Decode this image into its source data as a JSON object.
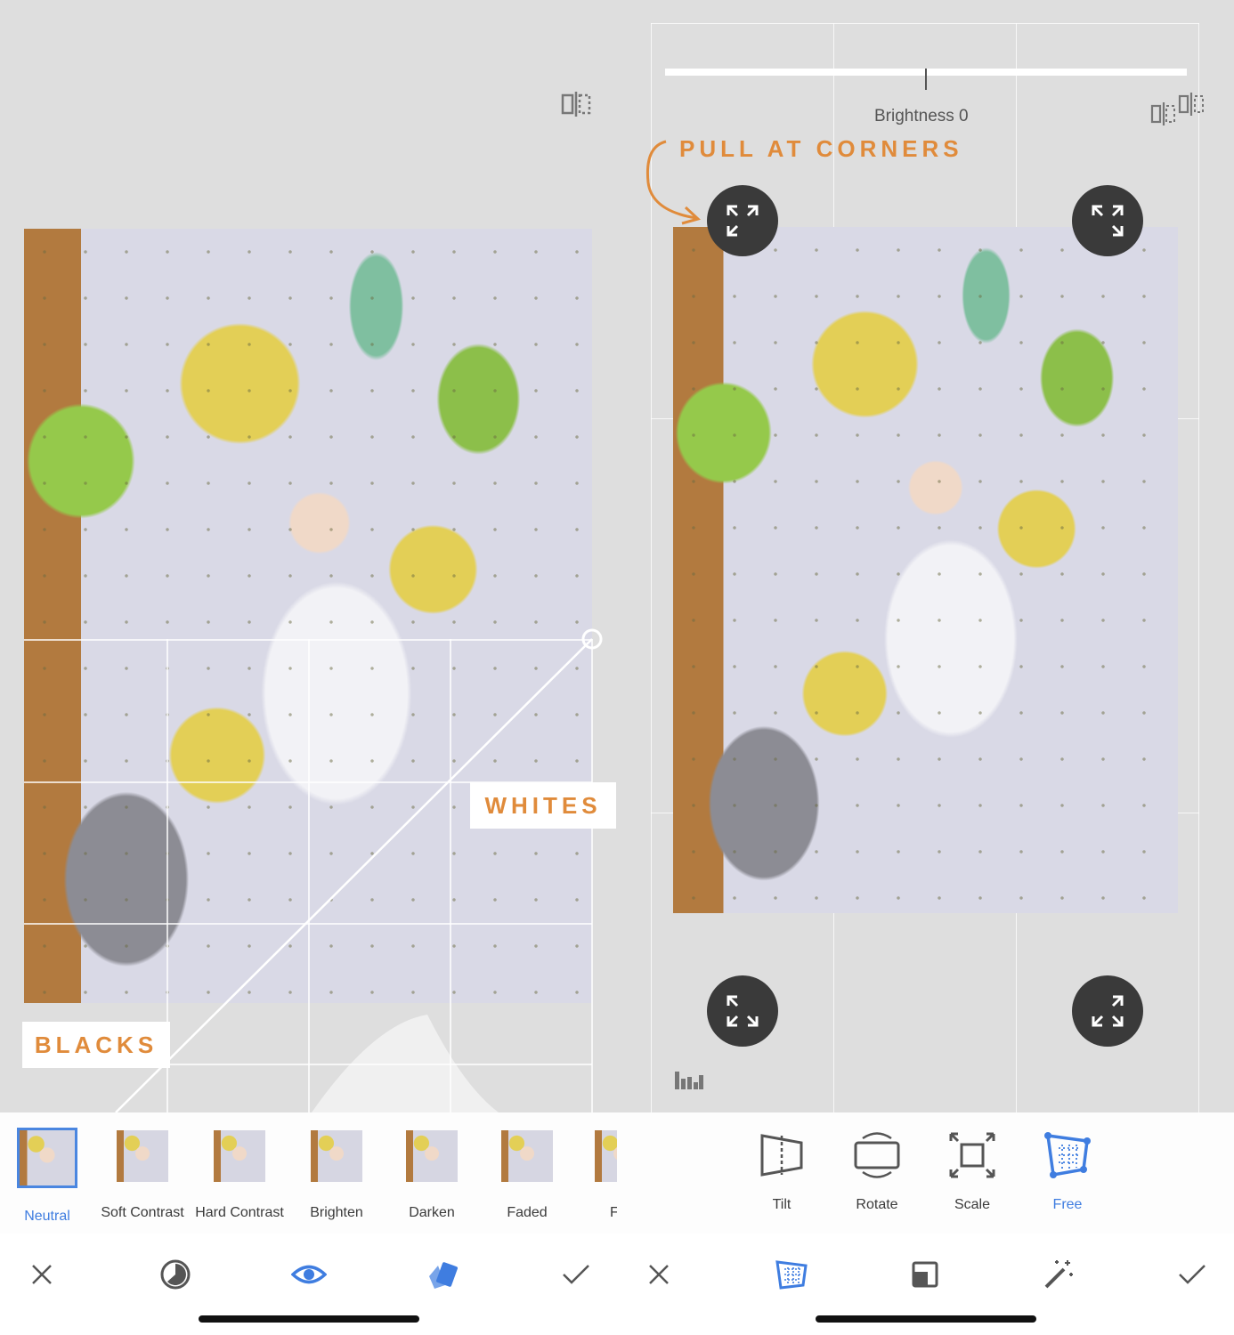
{
  "left": {
    "tags": {
      "whites": "WHITES",
      "blacks": "BLACKS"
    },
    "filters": [
      {
        "label": "Neutral",
        "active": true
      },
      {
        "label": "Soft Contrast",
        "active": false
      },
      {
        "label": "Hard Contrast",
        "active": false
      },
      {
        "label": "Brighten",
        "active": false
      },
      {
        "label": "Darken",
        "active": false
      },
      {
        "label": "Faded",
        "active": false
      },
      {
        "label": "F",
        "active": false
      }
    ],
    "bottom_icons": [
      "close-icon",
      "style-dial-icon",
      "preview-eye-icon",
      "styles-icon",
      "apply-check-icon"
    ]
  },
  "right": {
    "slider_label": "Brightness 0",
    "brightness_value": 0,
    "annotation": "PULL AT CORNERS",
    "tools": [
      {
        "label": "Tilt",
        "icon": "tilt-icon",
        "active": false
      },
      {
        "label": "Rotate",
        "icon": "rotate-icon",
        "active": false
      },
      {
        "label": "Scale",
        "icon": "scale-icon",
        "active": false
      },
      {
        "label": "Free",
        "icon": "free-transform-icon",
        "active": true
      }
    ],
    "bottom_icons": [
      "close-icon",
      "perspective-icon",
      "fill-icon",
      "auto-magic-icon",
      "apply-check-icon"
    ]
  },
  "colors": {
    "accent": "#3f7de0",
    "annotation": "#e08b3b",
    "button_dark": "#3a3a3a"
  }
}
